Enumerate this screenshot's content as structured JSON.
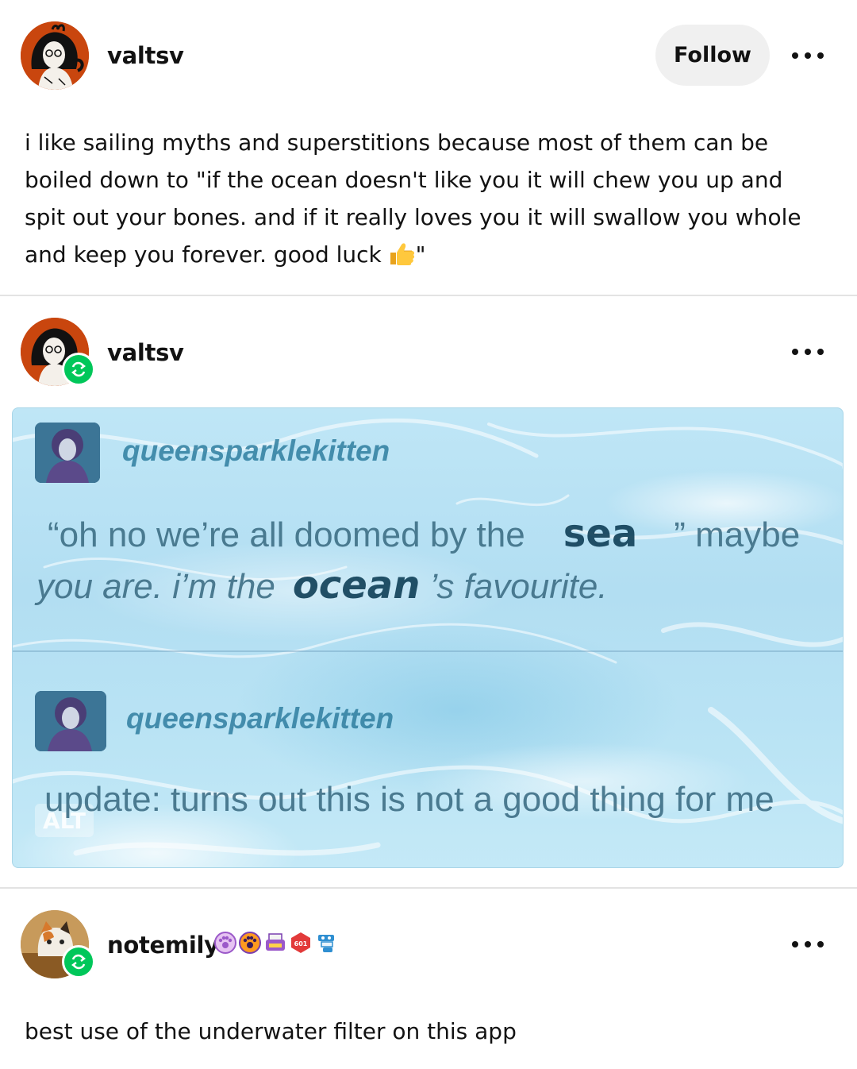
{
  "post": {
    "author": "valtsv",
    "follow_label": "Follow",
    "body": "i like sailing myths and superstitions because most of them can be boiled down to \"if the ocean doesn't like you it will chew you up and spit out your bones. and if it really loves you it will swallow you whole and keep you forever. good luck",
    "body_end": "\"",
    "emoji": "thumbs-up"
  },
  "reblog": {
    "author": "valtsv",
    "image": {
      "entries": [
        {
          "user": "queensparklekitten",
          "line1_a": "“oh no we’re all doomed by the",
          "line1_big": "sea",
          "line1_b": "” maybe",
          "line2_a": "you are. i’m the",
          "line2_big": "ocean",
          "line2_b": "’s favourite."
        },
        {
          "user": "queensparklekitten",
          "text": "update: turns out this is not a good thing for me"
        }
      ],
      "alt_label": "ALT"
    }
  },
  "comment": {
    "author": "notemily",
    "body": "best use of the underwater filter on this app"
  },
  "colors": {
    "reblog_green": "#00c75a",
    "follow_bg": "#f0f0f0",
    "avatar_orange": "#c9460e"
  }
}
